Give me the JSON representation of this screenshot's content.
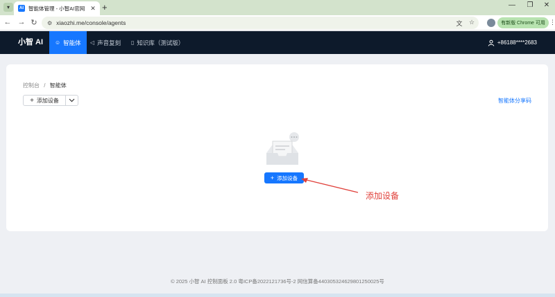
{
  "browser": {
    "tab_title": "智能体管理 - 小智AI官网",
    "favicon_text": "AI",
    "url": "xiaozhi.me/console/agents",
    "update_label": "有新版 Chrome 可用"
  },
  "app": {
    "brand": "小智 AI",
    "nav": [
      {
        "label": "智能体",
        "icon": "robot-icon",
        "active": true
      },
      {
        "label": "声音复刻",
        "icon": "speaker-icon",
        "active": false
      },
      {
        "label": "知识库（测试版）",
        "icon": "book-icon",
        "active": false
      }
    ],
    "user_phone": "+86188****2683"
  },
  "page": {
    "breadcrumb": {
      "root": "控制台",
      "sep": "/",
      "current": "智能体"
    },
    "add_button": "添加设备",
    "share_code": "智能体分享码",
    "empty_cta": "添加设备"
  },
  "annotation": {
    "text": "添加设备",
    "color": "#e0403a"
  },
  "footer": "© 2025 小智 AI 控制面板 2.0 粤ICP备2022121736号-2 网信算备440305324629801250025号",
  "colors": {
    "accent": "#1677ff",
    "header_bg": "#0d1a2b"
  }
}
